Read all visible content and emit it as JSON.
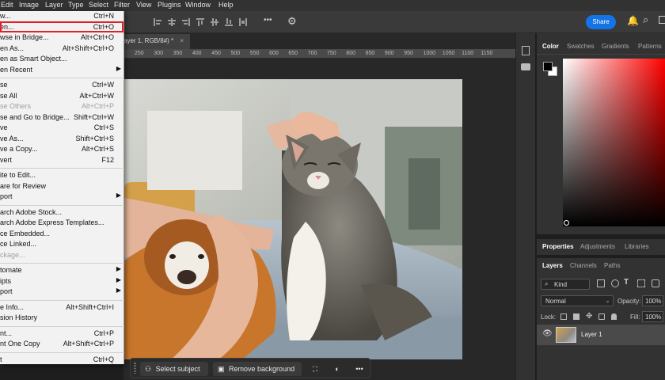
{
  "menubar": {
    "items": [
      "Edit",
      "Image",
      "Layer",
      "Type",
      "Select",
      "Filter",
      "View",
      "Plugins",
      "Window",
      "Help"
    ]
  },
  "file_menu": {
    "groups": [
      [
        {
          "label": "w...",
          "shortcut": "Ctrl+N"
        },
        {
          "label": "en...",
          "shortcut": "Ctrl+O",
          "highlighted": true
        },
        {
          "label": "wse in Bridge...",
          "shortcut": "Alt+Ctrl+O"
        },
        {
          "label": "en As...",
          "shortcut": "Alt+Shift+Ctrl+O"
        },
        {
          "label": "en as Smart Object..."
        },
        {
          "label": "en Recent",
          "submenu": true
        }
      ],
      [
        {
          "label": "se",
          "shortcut": "Ctrl+W"
        },
        {
          "label": "se All",
          "shortcut": "Alt+Ctrl+W"
        },
        {
          "label": "se Others",
          "shortcut": "Alt+Ctrl+P",
          "disabled": true
        },
        {
          "label": "se and Go to Bridge...",
          "shortcut": "Shift+Ctrl+W"
        },
        {
          "label": "ve",
          "shortcut": "Ctrl+S"
        },
        {
          "label": "ve As...",
          "shortcut": "Shift+Ctrl+S"
        },
        {
          "label": "ve a Copy...",
          "shortcut": "Alt+Ctrl+S"
        },
        {
          "label": "vert",
          "shortcut": "F12"
        }
      ],
      [
        {
          "label": "ite to Edit..."
        },
        {
          "label": "are for Review"
        },
        {
          "label": "port",
          "submenu": true
        }
      ],
      [
        {
          "label": "arch Adobe Stock..."
        },
        {
          "label": "arch Adobe Express Templates..."
        },
        {
          "label": "ce Embedded..."
        },
        {
          "label": "ce Linked..."
        },
        {
          "label": "ckage...",
          "disabled": true
        }
      ],
      [
        {
          "label": "tomate",
          "submenu": true
        },
        {
          "label": "ipts",
          "submenu": true
        },
        {
          "label": "port",
          "submenu": true
        }
      ],
      [
        {
          "label": "e Info...",
          "shortcut": "Alt+Shift+Ctrl+I"
        },
        {
          "label": "sion History"
        }
      ],
      [
        {
          "label": "nt...",
          "shortcut": "Ctrl+P"
        },
        {
          "label": "nt One Copy",
          "shortcut": "Alt+Shift+Ctrl+P"
        }
      ],
      [
        {
          "label": "t",
          "shortcut": "Ctrl+Q"
        }
      ]
    ]
  },
  "toolbar": {
    "share_label": "Share",
    "more_label": "•••"
  },
  "document": {
    "tab_label": "ayer 1, RGB/8#) *",
    "close_label": "×"
  },
  "ruler": {
    "ticks": [
      "250",
      "300",
      "350",
      "400",
      "450",
      "500",
      "550",
      "600",
      "650",
      "700",
      "750",
      "800",
      "850",
      "900",
      "950",
      "1000",
      "1050",
      "1100",
      "1150"
    ]
  },
  "color_panel": {
    "tabs": [
      "Color",
      "Swatches",
      "Gradients",
      "Patterns"
    ],
    "hue": "#ff0000"
  },
  "properties_panel": {
    "tabs": [
      "Properties",
      "Adjustments",
      "Libraries"
    ]
  },
  "layers_panel": {
    "tabs": [
      "Layers",
      "Channels",
      "Paths"
    ],
    "filter_label": "Kind",
    "blend_mode": "Normal",
    "opacity_label": "Opacity:",
    "opacity_value": "100%",
    "lock_label": "Lock:",
    "fill_label": "Fill:",
    "fill_value": "100%",
    "layers": [
      {
        "name": "Layer 1",
        "visible": true
      }
    ]
  },
  "context_bar": {
    "select_subject_label": "Select subject",
    "remove_background_label": "Remove background",
    "more_label": "•••"
  }
}
